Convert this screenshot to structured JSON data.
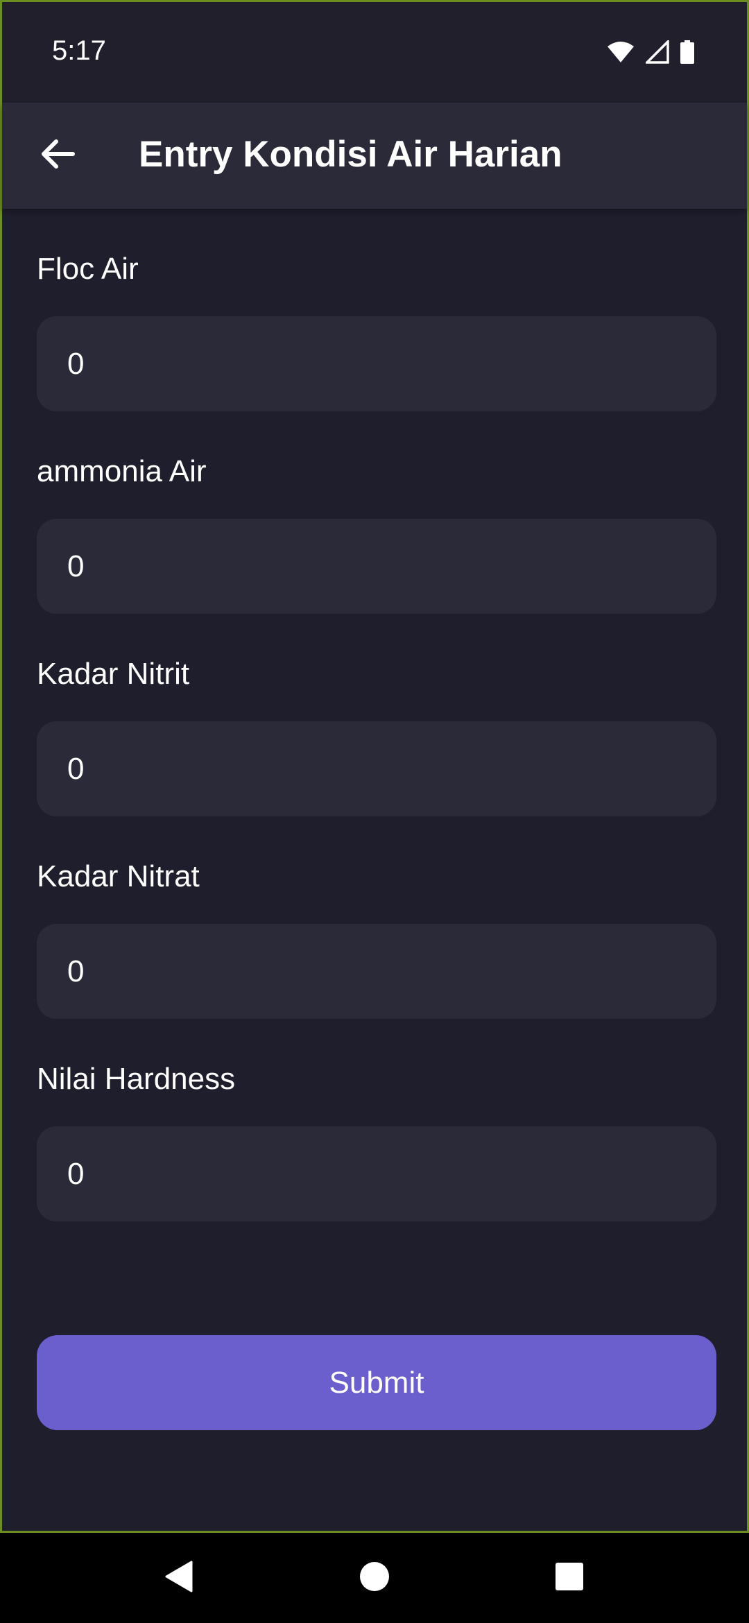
{
  "status_bar": {
    "time": "5:17",
    "icons": [
      "wifi-icon",
      "cell-signal-icon",
      "battery-icon"
    ]
  },
  "app_bar": {
    "back_icon": "arrow-left-icon",
    "title": "Entry Kondisi Air Harian"
  },
  "form": {
    "fields": [
      {
        "label": "Floc Air",
        "value": "0"
      },
      {
        "label": "ammonia Air",
        "value": "0"
      },
      {
        "label": "Kadar Nitrit",
        "value": "0"
      },
      {
        "label": "Kadar Nitrat",
        "value": "0"
      },
      {
        "label": "Nilai Hardness",
        "value": "0"
      }
    ],
    "submit_label": "Submit"
  },
  "nav_bar": {
    "buttons": [
      "back-triangle-icon",
      "home-circle-icon",
      "recents-square-icon"
    ]
  },
  "colors": {
    "background": "#1f1e2c",
    "surface": "#2b2a38",
    "accent": "#6b5ecd",
    "text": "#ffffff"
  }
}
